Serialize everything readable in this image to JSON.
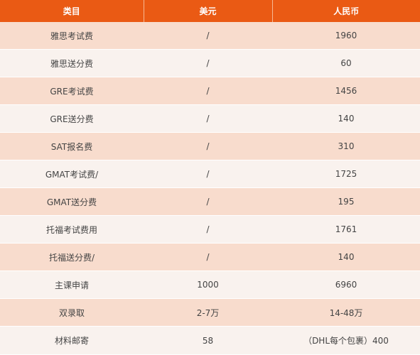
{
  "table": {
    "headers": [
      "类目",
      "美元",
      "人民币"
    ],
    "rows": [
      [
        "雅思考试费",
        "/",
        "1960"
      ],
      [
        "雅思送分费",
        "/",
        "60"
      ],
      [
        "GRE考试费",
        "/",
        "1456"
      ],
      [
        "GRE送分费",
        "/",
        "140"
      ],
      [
        "SAT报名费",
        "/",
        "310"
      ],
      [
        "GMAT考试费/",
        "/",
        "1725"
      ],
      [
        "GMAT送分费",
        "/",
        "195"
      ],
      [
        "托福考试费用",
        "/",
        "1761"
      ],
      [
        "托福送分费/",
        "/",
        "140"
      ],
      [
        "主课申请",
        "1000",
        "6960"
      ],
      [
        "双录取",
        "2-7万",
        "14-48万"
      ],
      [
        "材料邮寄",
        "58",
        "（DHL每个包裹）400"
      ]
    ],
    "colors": {
      "header_bg": "#ea5a14",
      "row_odd": "#f8dccd",
      "row_even": "#f9f2ee"
    }
  }
}
